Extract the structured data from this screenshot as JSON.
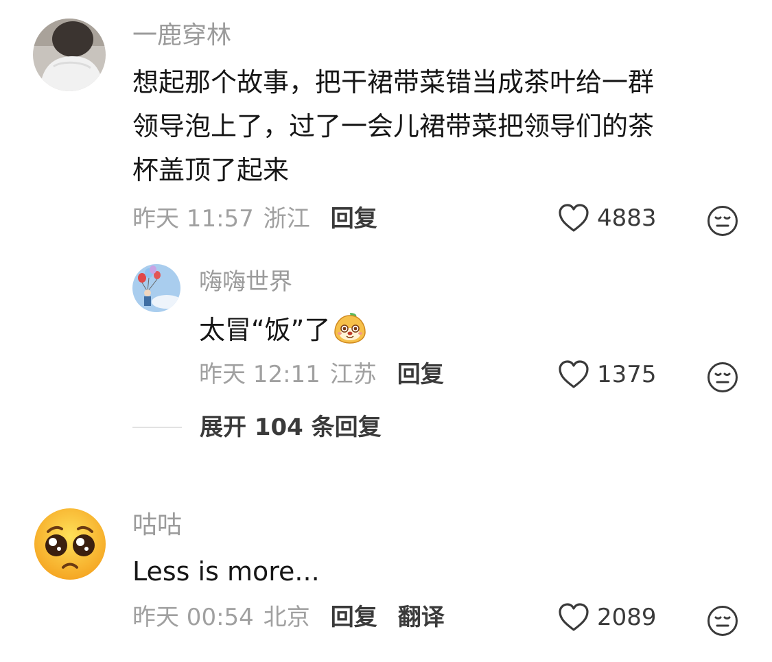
{
  "comments": [
    {
      "username": "一鹿穿林",
      "content_lines": [
        "想起那个故事，把干裙带菜错当成茶叶给一群",
        "领导泡上了，过了一会儿裙带菜把领导们的茶",
        "杯盖顶了起来"
      ],
      "time": "昨天 11:57",
      "location": "浙江",
      "reply_label": "回复",
      "likes": "4883",
      "avatar_icon": "photo-person-back-icon",
      "replies": [
        {
          "username": "嗨嗨世界",
          "content": "太冒“饭”了",
          "emoji_icon": "cartoon-mango-emoji-icon",
          "time": "昨天 12:11",
          "location": "江苏",
          "reply_label": "回复",
          "likes": "1375",
          "avatar_icon": "photo-balloons-person-icon"
        }
      ],
      "expand_label": "展开 104 条回复"
    },
    {
      "username": "咕咕",
      "content_lines": [
        "Less is more..."
      ],
      "time": "昨天 00:54",
      "location": "北京",
      "reply_label": "回复",
      "translate_label": "翻译",
      "likes": "2089",
      "avatar_icon": "pleading-face-emoji-icon"
    }
  ],
  "icons": {
    "like": "heart-outline-icon",
    "dislike": "neutral-face-outline-icon"
  },
  "colors": {
    "username": "#9b9b9b",
    "meta": "#a0a0a0",
    "text": "#161616",
    "action": "#3a3a3a"
  }
}
